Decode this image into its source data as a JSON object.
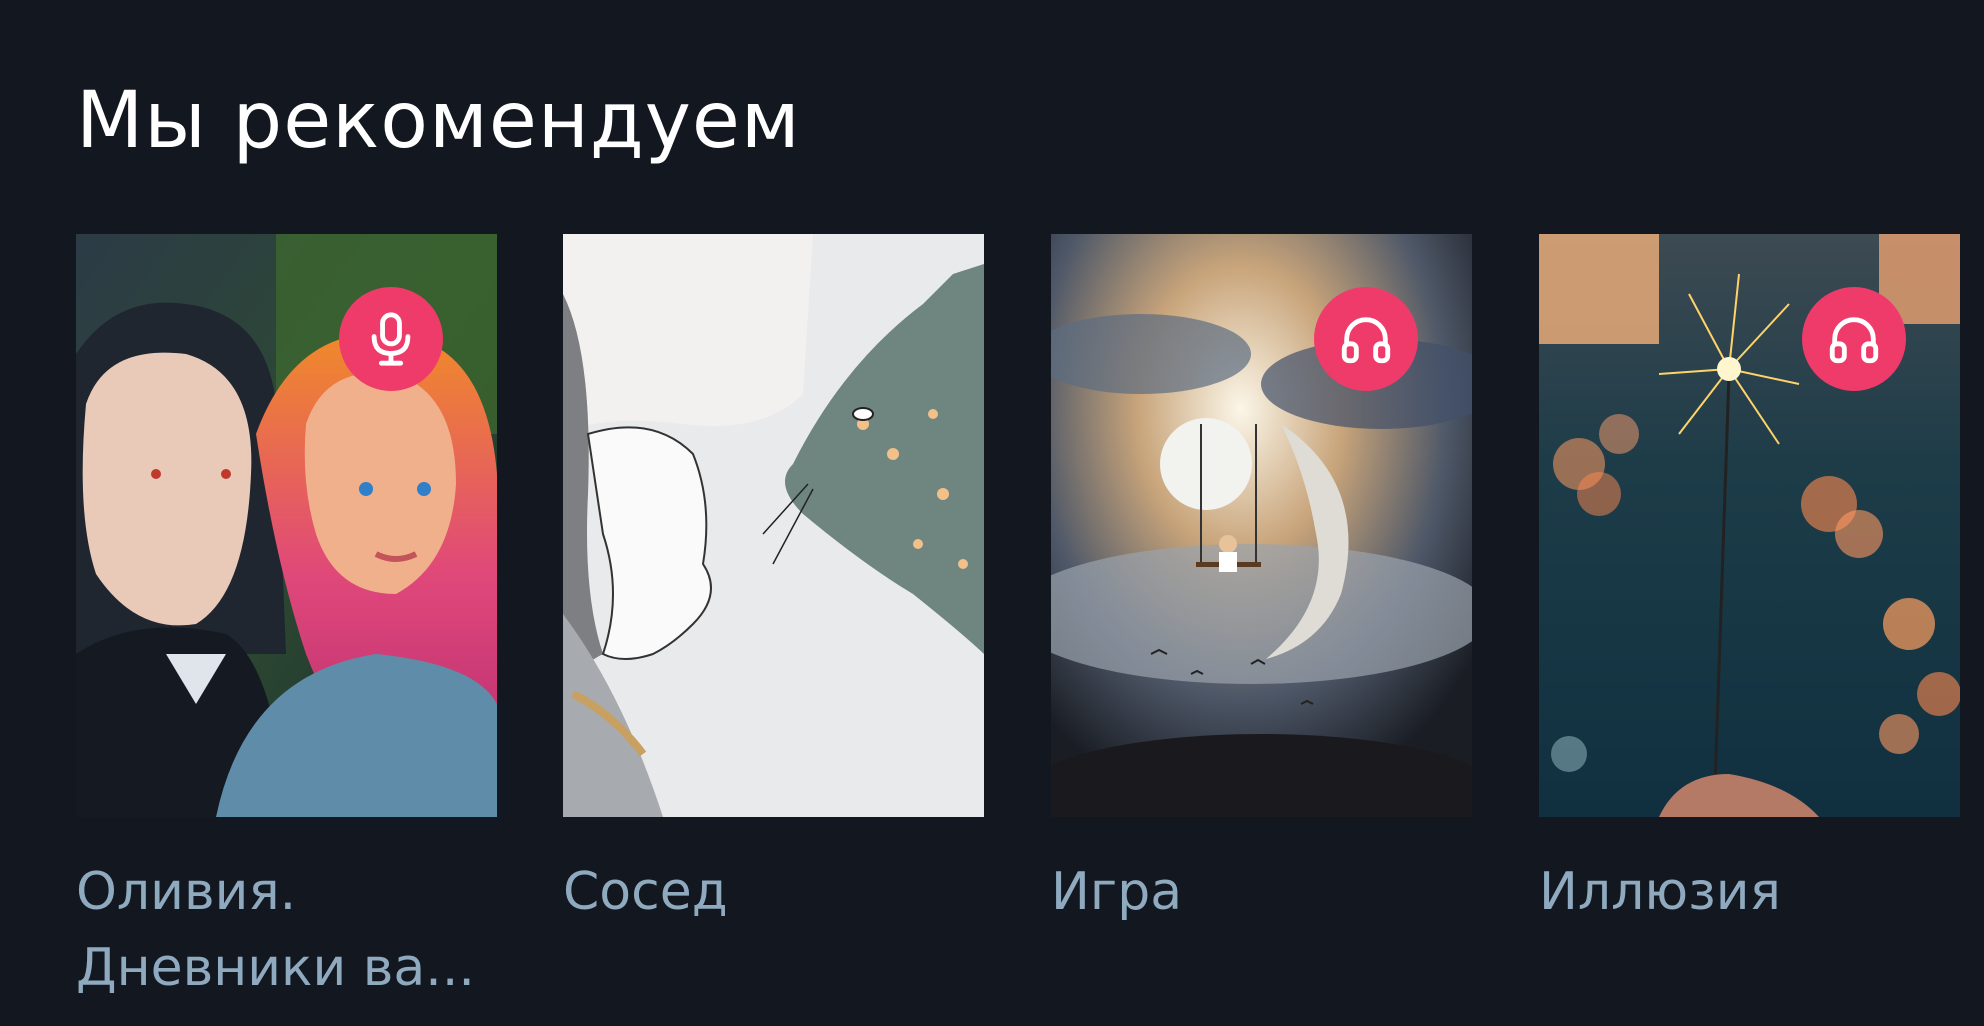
{
  "section": {
    "title": "Мы рекомендуем"
  },
  "books": [
    {
      "title": "Оливия.\nДневники ва...",
      "badge": "microphone-icon"
    },
    {
      "title": "Сосед",
      "badge": null
    },
    {
      "title": "Игра",
      "badge": "headphones-icon"
    },
    {
      "title": "Иллюзия",
      "badge": "headphones-icon"
    }
  ],
  "colors": {
    "background": "#131820",
    "badge": "#ef3b6a",
    "book_title": "#8fa9bf",
    "heading": "#ffffff"
  }
}
